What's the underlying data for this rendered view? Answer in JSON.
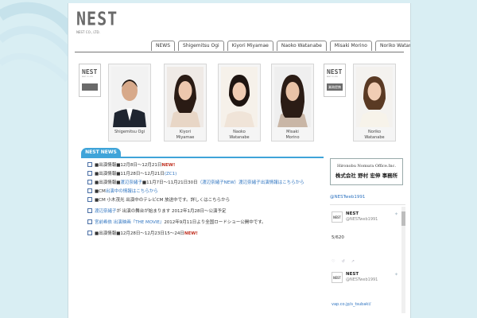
{
  "logo": {
    "word": "NEST",
    "sub": "NEST CO., LTD."
  },
  "nav": [
    {
      "label": "NEWS"
    },
    {
      "label": "Shigemitsu Ogi"
    },
    {
      "label": "Kiyori Miyamae"
    },
    {
      "label": "Naoko Watanabe"
    },
    {
      "label": "Misaki Morino"
    },
    {
      "label": "Noriko Watanabe"
    }
  ],
  "nest_boxes": [
    {
      "word": "NEST",
      "sub": "NEST CO.,LTD.",
      "bar": ""
    },
    {
      "word": "NEST",
      "sub": "NEST CO.,LTD.",
      "bar": "業務提携"
    }
  ],
  "talents": [
    {
      "name_line1": "Shigemitsu Ogi",
      "name_line2": ""
    },
    {
      "name_line1": "Kiyori",
      "name_line2": "Miyamae"
    },
    {
      "name_line1": "Naoko",
      "name_line2": "Watanabe"
    },
    {
      "name_line1": "Misaki",
      "name_line2": "Morino"
    },
    {
      "name_line1": "Noriko",
      "name_line2": "Watanabe"
    }
  ],
  "news": {
    "title": "NEST NEWS",
    "items": [
      {
        "text": "■出演情報■12月8日〜12月21日",
        "link": "",
        "badge": "NEW!"
      },
      {
        "text": "■出演情報■11月28日〜12月21日",
        "link": "(ZC1)",
        "badge": ""
      },
      {
        "text": "■出演情報■",
        "link": "渡辺奈緒子",
        "rest": "■11月7日〜11月21日30日",
        "link2": "（渡辺奈緒子NEW）渡辺奈緒子出演情報はこちらから",
        "badge": ""
      },
      {
        "text": "■CM",
        "link": "出演中の情報はこちらから",
        "badge": ""
      },
      {
        "text": "■CM 小木茂光 出演中のテレビCM 放送中です。詳しくはこちらから",
        "link": "",
        "badge": ""
      },
      {
        "text": "",
        "link": "渡辺奈緒子",
        "rest": "が 出演の舞台が始まります 2012年1月28日〜公演予定",
        "badge": ""
      },
      {
        "text": "",
        "link": "宮前希依 出演映画『THE MOVIE』",
        "rest": "2012年9月11日より全国ロードショー公開中です。",
        "badge": ""
      },
      {
        "text": "■出演情報■12月28日〜12月23日15〜24日",
        "link": "",
        "badge": "NEW!"
      }
    ]
  },
  "office": {
    "en": "Hironobu Nomura Office.Inc.",
    "jp": "株式会社 野村 宏伸 事務所"
  },
  "twitter": {
    "link": "@NESTweb1991",
    "tweets": [
      {
        "avatar": "NEST",
        "name": "NEST",
        "handle": "@NESTweb1991",
        "text": "5/620"
      },
      {
        "avatar": "NEST",
        "name": "NEST",
        "handle": "@NESTweb1991",
        "text": ""
      }
    ]
  },
  "footer_link": "vap.co.jp/s_tsubaki/"
}
